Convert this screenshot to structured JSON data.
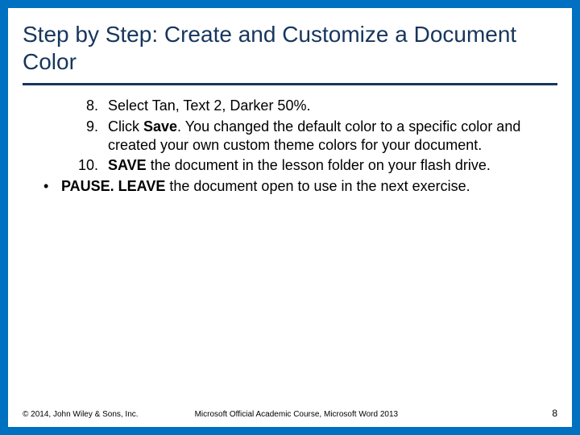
{
  "title": "Step by Step: Create and Customize a Document Color",
  "steps": [
    {
      "n": "8.",
      "before": "Select Tan, Text 2, Darker 50%.",
      "bold": "",
      "after": ""
    },
    {
      "n": "9.",
      "before": "Click ",
      "bold": "Save",
      "after": ". You changed the default color to a specific color and created your own custom theme colors for your document."
    },
    {
      "n": "10.",
      "before": " ",
      "bold": "SAVE",
      "after": " the document in the lesson folder on your flash drive."
    }
  ],
  "closing": {
    "bold": "PAUSE. LEAVE",
    "after": " the document open to use in the next exercise."
  },
  "footer": {
    "copyright": "© 2014, John Wiley & Sons, Inc.",
    "course": "Microsoft Official Academic Course, Microsoft Word 2013",
    "page": "8"
  }
}
